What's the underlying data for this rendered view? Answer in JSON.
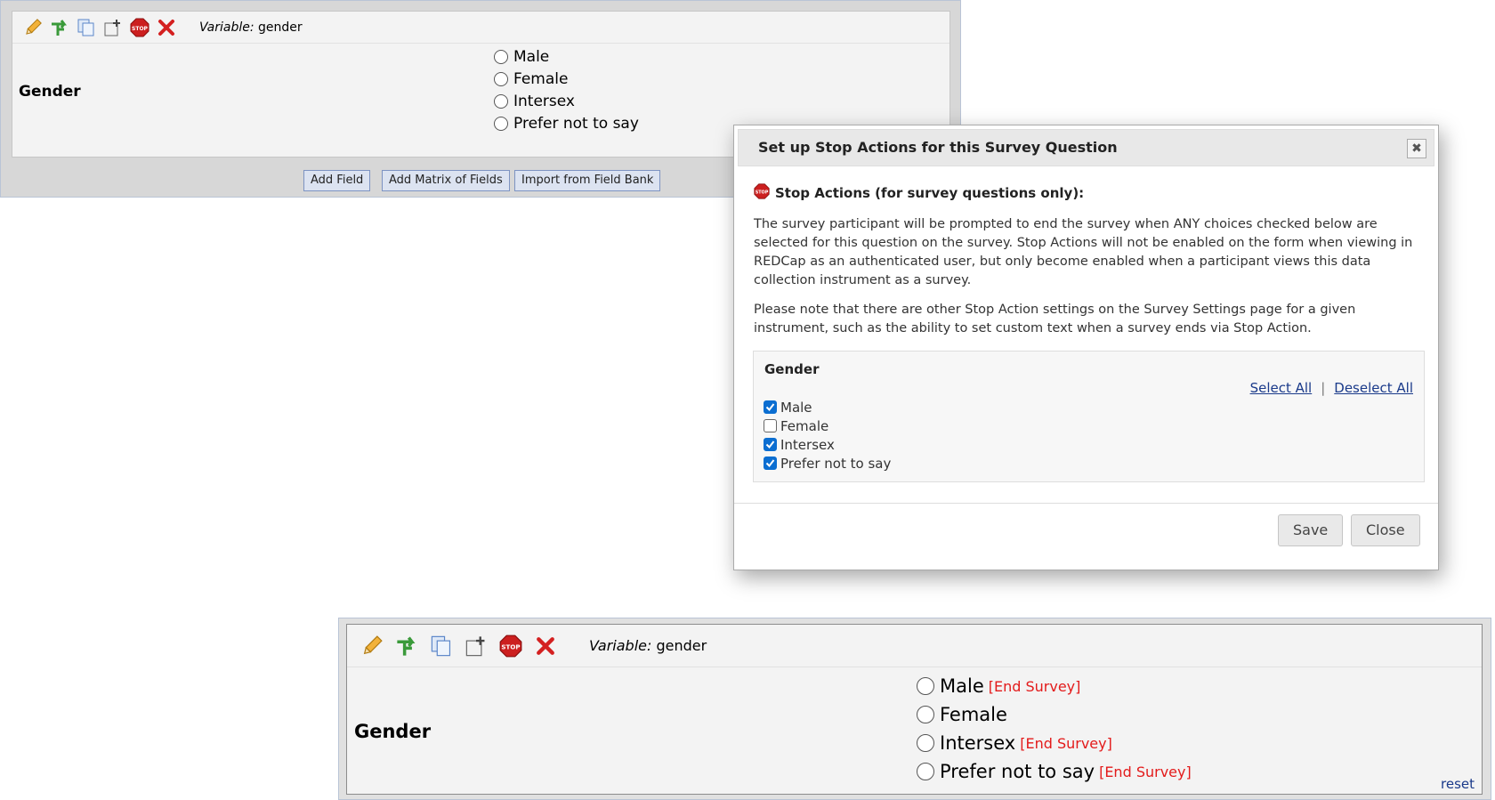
{
  "top": {
    "toolbar": {
      "icons": [
        "edit-pencil-icon",
        "branching-logic-icon",
        "copy-field-icon",
        "move-field-icon",
        "stop-action-icon",
        "delete-field-icon"
      ],
      "variable_prefix": "Variable:",
      "variable_name": "gender"
    },
    "field_label": "Gender",
    "choices": [
      "Male",
      "Female",
      "Intersex",
      "Prefer not to say"
    ],
    "buttons": {
      "add_field": "Add Field",
      "add_matrix": "Add Matrix of Fields",
      "import_bank": "Import from Field Bank"
    }
  },
  "dialog": {
    "title": "Set up Stop Actions for this Survey Question",
    "close_icon": "close-icon",
    "stop_actions_heading": "Stop Actions (for survey questions only):",
    "paragraph1": "The survey participant will be prompted to end the survey when ANY choices checked below are selected for this question on the survey. Stop Actions will not be enabled on the form when viewing in REDCap as an authenticated user, but only become enabled when a participant views this data collection instrument as a survey.",
    "paragraph2": "Please note that there are other Stop Action settings on the Survey Settings page for a given instrument, such as the ability to set custom text when a survey ends via Stop Action.",
    "box_title": "Gender",
    "select_all": "Select All",
    "separator": "|",
    "deselect_all": "Deselect All",
    "options": [
      {
        "label": "Male",
        "checked": true
      },
      {
        "label": "Female",
        "checked": false
      },
      {
        "label": "Intersex",
        "checked": true
      },
      {
        "label": "Prefer not to say",
        "checked": true
      }
    ],
    "save_label": "Save",
    "close_label": "Close"
  },
  "bottom": {
    "variable_prefix": "Variable:",
    "variable_name": "gender",
    "field_label": "Gender",
    "choices": [
      {
        "label": "Male",
        "tag": "[End Survey]"
      },
      {
        "label": "Female",
        "tag": ""
      },
      {
        "label": "Intersex",
        "tag": "[End Survey]"
      },
      {
        "label": "Prefer not to say",
        "tag": "[End Survey]"
      }
    ],
    "reset_label": "reset"
  },
  "colors": {
    "end_survey": "#e31b1b",
    "link": "#1a3a8a",
    "checkbox_checked": "#0b6ed1",
    "stop_sign": "#cc1f1f"
  }
}
